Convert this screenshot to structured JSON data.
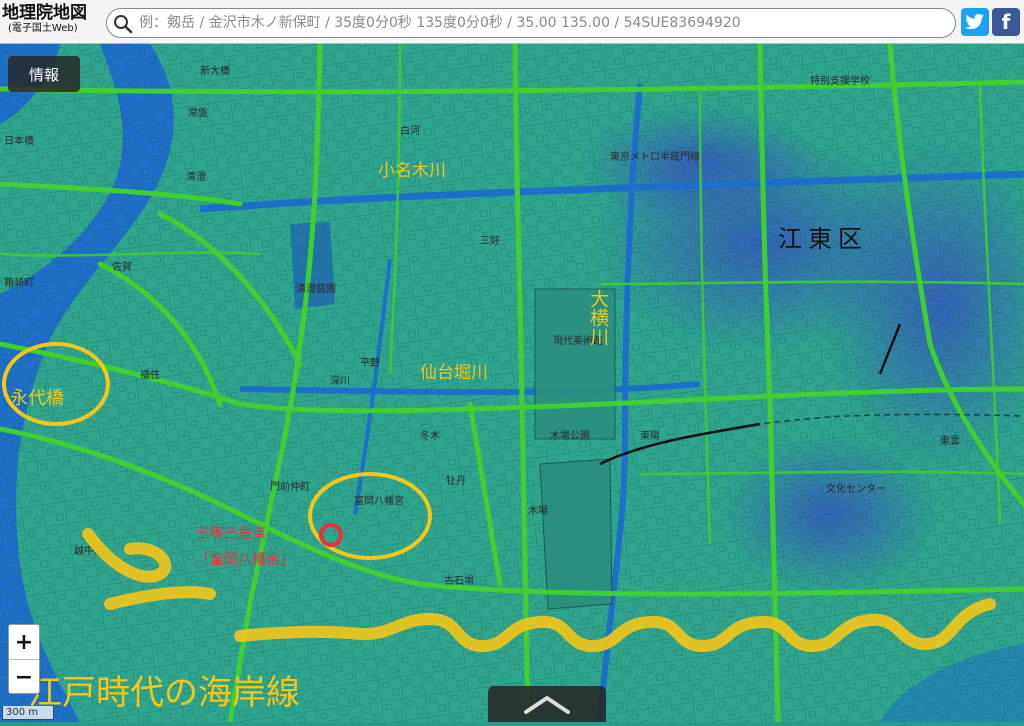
{
  "header": {
    "logo_main": "地理院地図",
    "logo_sub": "(電子国土Web)",
    "search_placeholder": "例：剱岳 / 金沢市木ノ新保町 / 35度0分0秒 135度0分0秒 / 35.00 135.00 / 54SUE83694920",
    "twitter_icon": "twitter-bird-icon",
    "facebook_letter": "f",
    "twitter_color": "#1da1f2",
    "facebook_color": "#3b5998"
  },
  "controls": {
    "info_label": "情報",
    "zoom_in": "+",
    "zoom_out": "−",
    "scale_label": "300 m",
    "bottom_panel_icon": "chevron-up-icon"
  },
  "map": {
    "colors": {
      "water": "#1e6fc9",
      "land_high": "#2fa58e",
      "land_low": "#2f6fb8",
      "road": "#3fcf2f",
      "annotation_yellow": "#f5c518",
      "annotation_red": "#e8303a"
    },
    "labels": {
      "onagigawa": "小名木川",
      "yokojikkengawa": "大横川",
      "sendaiborigawa": "仙台堀川",
      "koto_ku": "江東区",
      "eitaibashi": "永代橋",
      "triangulation": "三等三角点",
      "triangulation_sub": "「富岡八幡宮」",
      "coastline": "江戸時代の海岸線"
    },
    "streets": {
      "s1": "常盤",
      "s2": "清澄庭園",
      "s3": "東京メトロ半蔵門線",
      "s4": "現代美術館",
      "s5": "木場公園",
      "s6": "富岡八幡宮",
      "s7": "清澄",
      "s8": "平野",
      "s9": "深川",
      "s10": "門前仲町",
      "s11": "佐賀",
      "s12": "福住",
      "s13": "越中島",
      "s14": "特別支援学校",
      "s15": "文化センター",
      "s16": "東陽",
      "s17": "木場",
      "s18": "日本橋",
      "s19": "箱崎町",
      "s20": "新大橋",
      "s21": "白河",
      "s22": "三好",
      "s23": "冬木",
      "s24": "牡丹",
      "s25": "古石場",
      "s26": "東雲"
    }
  }
}
